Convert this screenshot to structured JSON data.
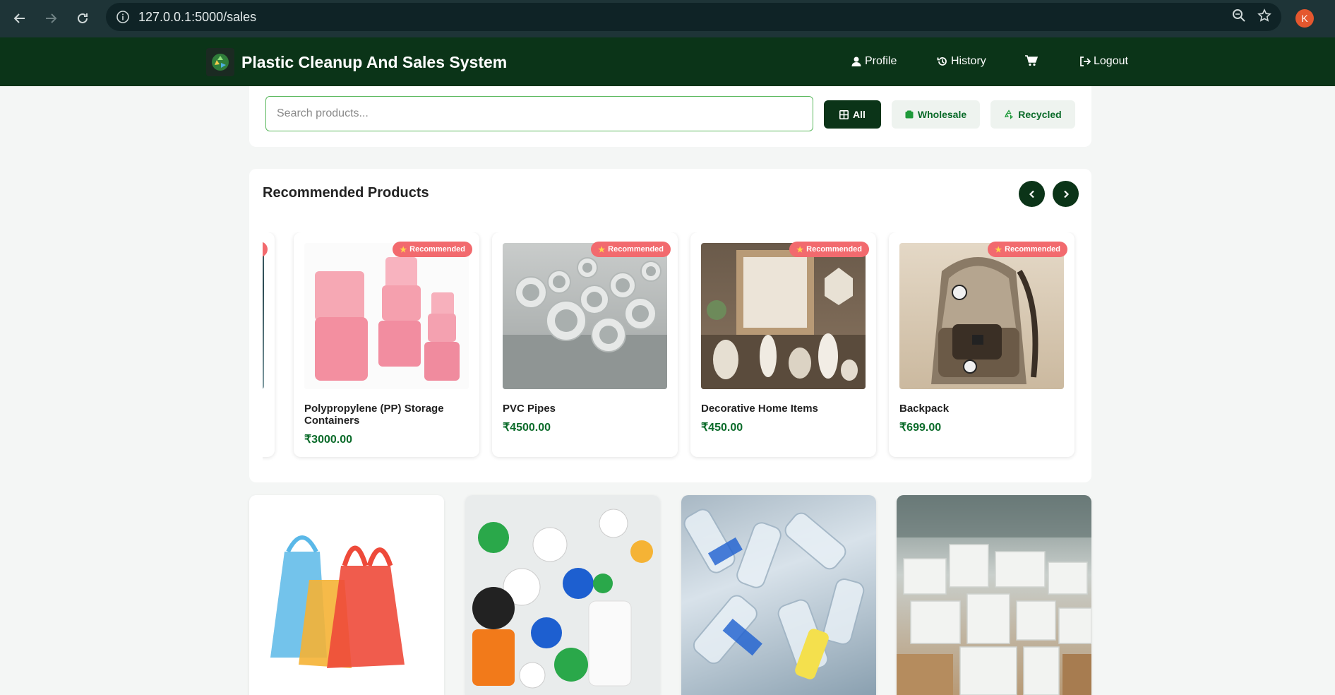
{
  "browser": {
    "url": "127.0.0.1:5000/sales",
    "profile_initial": "K"
  },
  "navbar": {
    "title": "Plastic Cleanup And Sales System",
    "links": [
      {
        "label": "Profile",
        "icon": "user-icon"
      },
      {
        "label": "History",
        "icon": "history-icon"
      },
      {
        "label": "",
        "icon": "cart-icon"
      },
      {
        "label": "Logout",
        "icon": "logout-icon"
      }
    ]
  },
  "search": {
    "placeholder": "Search products...",
    "filters": [
      {
        "label": "All",
        "icon": "grid-icon",
        "active": true
      },
      {
        "label": "Wholesale",
        "icon": "box-icon",
        "active": false
      },
      {
        "label": "Recycled",
        "icon": "recycle-icon",
        "active": false
      }
    ]
  },
  "recommended": {
    "title": "Recommended Products",
    "badge": "Recommended",
    "products": [
      {
        "name": "Polypropylene (PP) Storage Containers",
        "price": "₹3000.00",
        "image": "pink-storage-containers"
      },
      {
        "name": "PVC Pipes",
        "price": "₹4500.00",
        "image": "pvc-pipes"
      },
      {
        "name": "Decorative Home Items",
        "price": "₹450.00",
        "image": "decorative-home-items"
      },
      {
        "name": "Backpack",
        "price": "₹699.00",
        "image": "backpack"
      }
    ]
  },
  "grid": {
    "items": [
      {
        "image": "plastic-bags"
      },
      {
        "image": "bottle-caps"
      },
      {
        "image": "pet-bottles"
      },
      {
        "image": "styrofoam-blocks"
      }
    ]
  },
  "colors": {
    "brand_dark": "#0b3418",
    "price_green": "#0b6b2a",
    "badge_red": "#f26a6e",
    "chrome_bg": "#1e3437"
  }
}
